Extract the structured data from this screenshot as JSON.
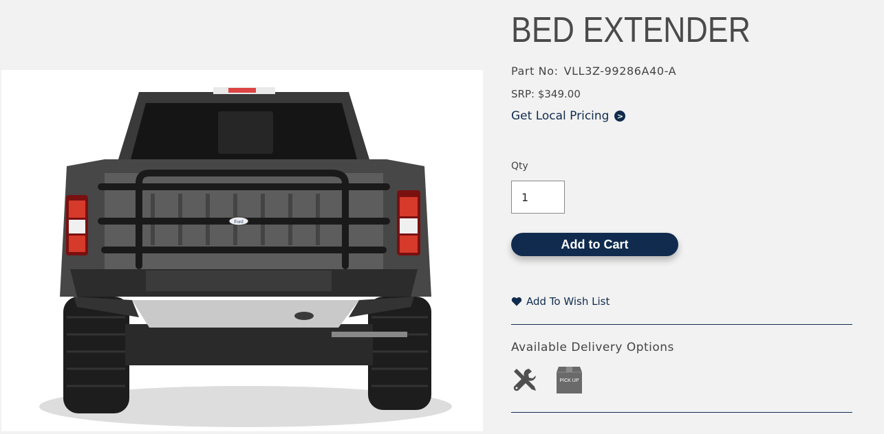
{
  "product": {
    "title": "BED EXTENDER",
    "part_label": "Part No:",
    "part_number": "VLL3Z-99286A40-A",
    "srp_label": "SRP:",
    "srp_value": "$349.00",
    "local_pricing": "Get Local Pricing",
    "local_pricing_icon": "chevron-right-circle-icon"
  },
  "quantity": {
    "label": "Qty",
    "value": "1"
  },
  "cart": {
    "add_label": "Add to Cart"
  },
  "wishlist": {
    "label": "Add To Wish List",
    "icon": "heart-icon"
  },
  "delivery": {
    "label": "Available Delivery Options",
    "options": [
      {
        "icon": "tools-install-icon"
      },
      {
        "icon": "pickup-box-icon",
        "text": "PICK UP"
      }
    ]
  },
  "image": {
    "logo_text": "Ford"
  },
  "colors": {
    "brand": "#102b4e",
    "background": "#f2f2f2"
  }
}
